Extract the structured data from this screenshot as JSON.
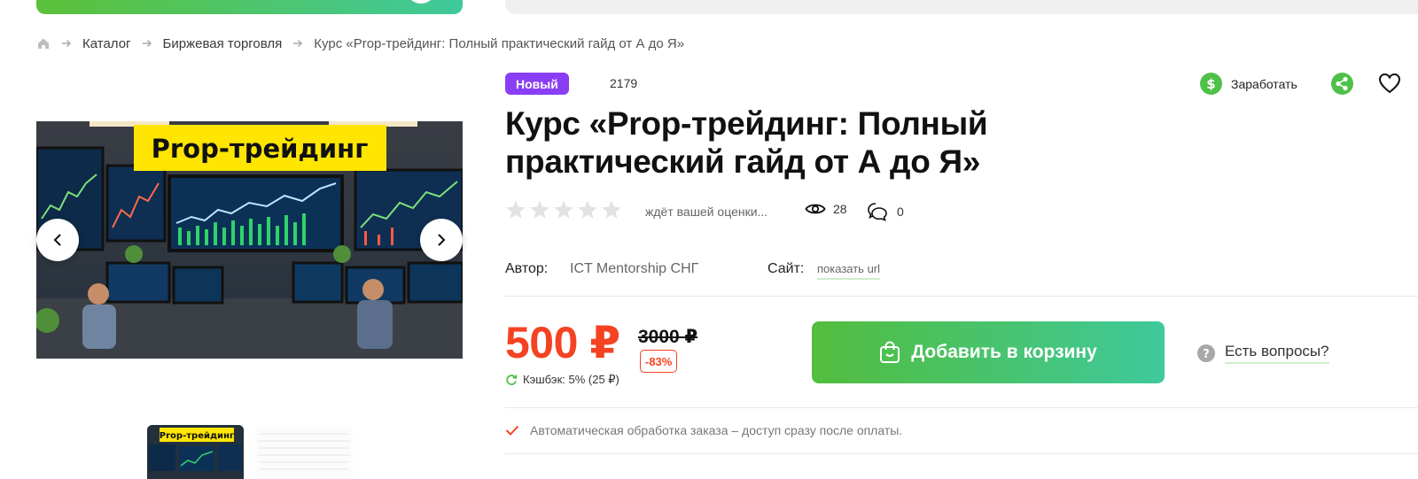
{
  "breadcrumb": {
    "items": [
      "Каталог",
      "Биржевая торговля",
      "Курс «Prop-трейдинг: Полный практический гайд от А до Я»"
    ]
  },
  "gallery": {
    "banner_text": "Prop-трейдинг",
    "thumb_banner_text": "Prop-трейдинг"
  },
  "product": {
    "badge": "Новый",
    "code": "2179",
    "title": "Курс «Prop-трейдинг: Полный практический гайд от А до Я»",
    "rating_text": "ждёт вашей оценки...",
    "rating_value": 0,
    "views": "28",
    "comments": "0",
    "author_label": "Автор:",
    "author": "ICT Mentorship СНГ",
    "site_label": "Сайт:",
    "site_link": "показать url",
    "price": "500 ₽",
    "old_price": "3000 ₽",
    "discount": "-83%",
    "cashback": "Кэшбэк: 5% (25 ₽)",
    "add_to_cart": "Добавить в корзину",
    "questions": "Есть вопросы?",
    "auto_processing": "Автоматическая обработка заказа – доступ сразу после оплаты."
  },
  "actions": {
    "earn": "Заработать"
  },
  "colors": {
    "accent_green": "#4fc04a",
    "price_red": "#f44322",
    "badge_purple": "#8a3ef3"
  }
}
